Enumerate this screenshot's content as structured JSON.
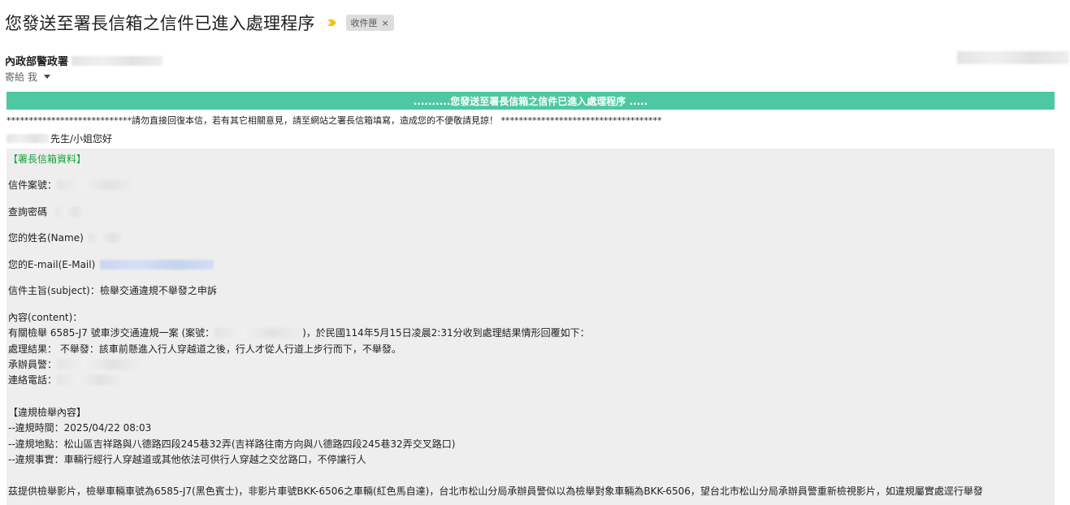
{
  "email": {
    "subject": "您發送至署長信箱之信件已進入處理程序",
    "label_chip": "收件匣",
    "label_chip_close": "×",
    "sender_name": "內政部警政署",
    "recipient_prefix": "寄給 我"
  },
  "body": {
    "banner": "..........您發送至署長信箱之信件已進入處理程序 .....",
    "notice": "****************************請勿直接回復本信，若有其它相關意見，請至網站之署長信箱填寫，造成您的不便敬請見諒！ ************************************",
    "greeting_suffix": "先生/小姐您好",
    "section_heading": "【署長信箱資料】",
    "case_no_label": "信件案號：",
    "query_password_label": "查詢密碼",
    "name_label": "您的姓名(Name)",
    "email_label": "您的E-mail(E-Mail)",
    "subject_line": "信件主旨(subject)：檢舉交通違規不舉發之申訴",
    "content_label": "內容(content)：",
    "content_line1_prefix": "有關檢舉 6585-J7 號車涉交通違規一案 (案號：",
    "content_line1_suffix": ")，於民國114年5月15日凌晨2:31分收到處理結果情形回覆如下：",
    "result_line": "處理結果： 不舉發：該車前懸進入行人穿越道之後，行人才從人行道上步行而下，不舉發。",
    "officer_label": "承辦員警：",
    "phone_label": "連絡電話：",
    "violation_heading": "【違規檢舉內容】",
    "violation_time": "--違規時間：2025/04/22 08:03",
    "violation_place": "--違規地點：松山區吉祥路與八德路四段245巷32弄(吉祥路往南方向與八德路四段245巷32弄交叉路口)",
    "violation_fact": "--違規事實：車輛行經行人穿越道或其他依法可供行人穿越之交岔路口，不停讓行人",
    "bottom_line": "茲提供檢舉影片，檢舉車輛車號為6585-J7(黑色賓士)，非影片車號BKK-6506之車輛(紅色馬自達)，台北市松山分局承辦員警似以為檢舉對象車輛為BKK-6506，望台北市松山分局承辦員警重新檢視影片，如違規屬實處逕行舉發"
  },
  "colors": {
    "banner": "#4ec8a0",
    "panel": "#eeeeee",
    "heading_green": "#18a33c",
    "importance_marker": "#f4c20d"
  },
  "icons": {
    "importance": "importance-marker-icon",
    "dropdown": "caret-down-icon"
  }
}
